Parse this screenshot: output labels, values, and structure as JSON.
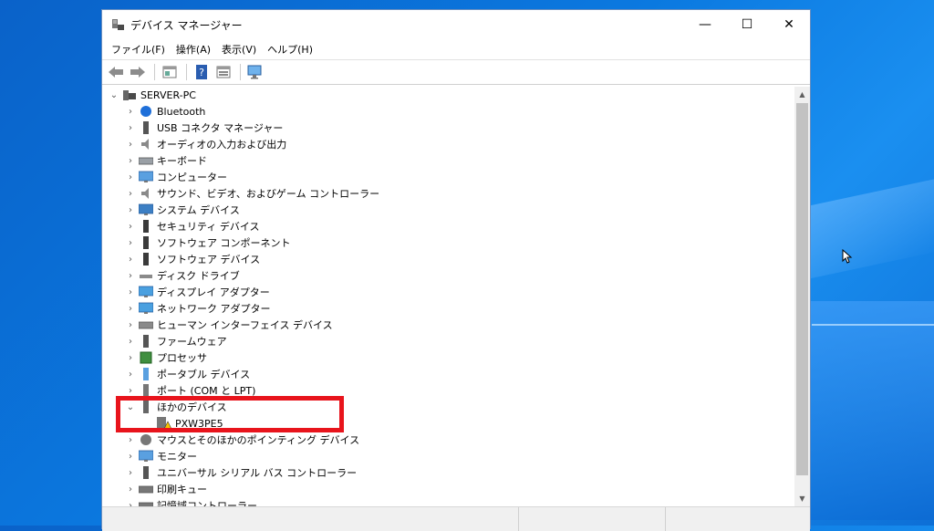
{
  "window": {
    "title": "デバイス マネージャー",
    "controls": {
      "minimize": "—",
      "maximize": "☐",
      "close": "✕"
    }
  },
  "menu": [
    "ファイル(F)",
    "操作(A)",
    "表示(V)",
    "ヘルプ(H)"
  ],
  "toolbar": [
    "back-icon",
    "forward-icon",
    "properties-icon",
    "help-icon",
    "view-icon",
    "scan-hardware-icon"
  ],
  "tree": {
    "root": "SERVER-PC",
    "items": [
      {
        "label": "Bluetooth",
        "icon": "bluetooth-icon"
      },
      {
        "label": "USB コネクタ マネージャー",
        "icon": "usb-icon"
      },
      {
        "label": "オーディオの入力および出力",
        "icon": "speaker-icon"
      },
      {
        "label": "キーボード",
        "icon": "keyboard-icon"
      },
      {
        "label": "コンピューター",
        "icon": "computer-icon"
      },
      {
        "label": "サウンド、ビデオ、およびゲーム コントローラー",
        "icon": "speaker-icon"
      },
      {
        "label": "システム デバイス",
        "icon": "system-icon"
      },
      {
        "label": "セキュリティ デバイス",
        "icon": "security-icon"
      },
      {
        "label": "ソフトウェア コンポーネント",
        "icon": "software-icon"
      },
      {
        "label": "ソフトウェア デバイス",
        "icon": "software-icon"
      },
      {
        "label": "ディスク ドライブ",
        "icon": "disk-icon"
      },
      {
        "label": "ディスプレイ アダプター",
        "icon": "display-icon"
      },
      {
        "label": "ネットワーク アダプター",
        "icon": "network-icon"
      },
      {
        "label": "ヒューマン インターフェイス デバイス",
        "icon": "hid-icon"
      },
      {
        "label": "ファームウェア",
        "icon": "firmware-icon"
      },
      {
        "label": "プロセッサ",
        "icon": "processor-icon"
      },
      {
        "label": "ポータブル デバイス",
        "icon": "portable-icon"
      },
      {
        "label": "ポート (COM と LPT)",
        "icon": "port-icon"
      },
      {
        "label": "ほかのデバイス",
        "icon": "other-devices-icon",
        "expanded": true
      },
      {
        "label": "PXW3PE5",
        "icon": "warning-device-icon",
        "child": true
      },
      {
        "label": "マウスとそのほかのポインティング デバイス",
        "icon": "mouse-icon"
      },
      {
        "label": "モニター",
        "icon": "monitor-icon"
      },
      {
        "label": "ユニバーサル シリアル バス コントローラー",
        "icon": "usb-icon"
      },
      {
        "label": "印刷キュー",
        "icon": "printer-icon"
      },
      {
        "label": "記憶域コントローラー",
        "icon": "storage-icon"
      }
    ]
  },
  "colors": {
    "highlight": "#e8141c",
    "desktop": "#0b79e0"
  }
}
